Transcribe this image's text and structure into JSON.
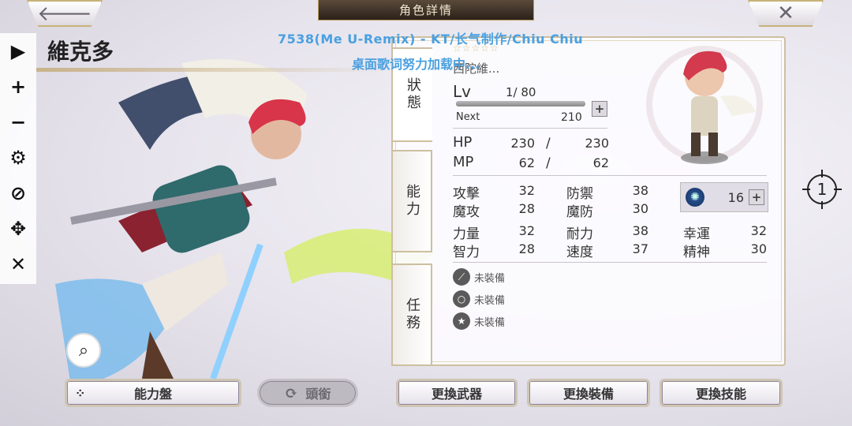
{
  "header": {
    "back_icon": "arrow-left-icon",
    "title": "角色詳情",
    "close_icon": "close-icon"
  },
  "toolbar": {
    "items": [
      "play-icon",
      "plus-icon",
      "minus-icon",
      "gear-icon",
      "eye-off-icon",
      "move-icon",
      "close-icon"
    ],
    "glyphs": [
      "▶",
      "+",
      "−",
      "⚙",
      "⊘",
      "✥",
      "✕"
    ]
  },
  "character": {
    "name": "維克多",
    "sub_name": "西陀維...",
    "stars": "☆☆☆☆☆"
  },
  "overlay": {
    "line1": "7538(Me U-Remix) - KT/长气制作/Chiu Chiu",
    "line2": "桌面歌词努力加载中..."
  },
  "tabs": {
    "status": "狀態",
    "ability": "能力",
    "mission": "任務"
  },
  "level": {
    "label": "Lv",
    "value": "1/ 80",
    "next_label": "Next",
    "next_value": "210",
    "xp_fraction": 0.0
  },
  "vitals": {
    "hp_label": "HP",
    "hp_cur": "230",
    "hp_max": "230",
    "mp_label": "MP",
    "mp_cur": "62",
    "mp_max": "62",
    "sep": "/"
  },
  "stats": [
    {
      "label": "攻擊",
      "value": "32"
    },
    {
      "label": "防禦",
      "value": "38"
    },
    {
      "label": "魔攻",
      "value": "28"
    },
    {
      "label": "魔防",
      "value": "30"
    },
    {
      "label": "力量",
      "value": "32"
    },
    {
      "label": "耐力",
      "value": "38"
    },
    {
      "label": "幸運",
      "value": "32"
    },
    {
      "label": "智力",
      "value": "28"
    },
    {
      "label": "速度",
      "value": "37"
    },
    {
      "label": "精神",
      "value": "30"
    }
  ],
  "rune": {
    "value": "16"
  },
  "equipment": [
    {
      "label": "未裝備",
      "icon": "weapon-slot-icon"
    },
    {
      "label": "未裝備",
      "icon": "ring-slot-icon"
    },
    {
      "label": "未裝備",
      "icon": "badge-slot-icon"
    }
  ],
  "buttons": {
    "ability_board": "能力盤",
    "title_btn": "頭銜",
    "change_weapon": "更換武器",
    "change_equip": "更換裝備",
    "change_skill": "更換技能"
  },
  "target": {
    "number": "1"
  },
  "colors": {
    "accent_gold": "#c8b27a",
    "lyric_blue": "#4aa0e0",
    "panel_bg": "#fcfbfe"
  }
}
